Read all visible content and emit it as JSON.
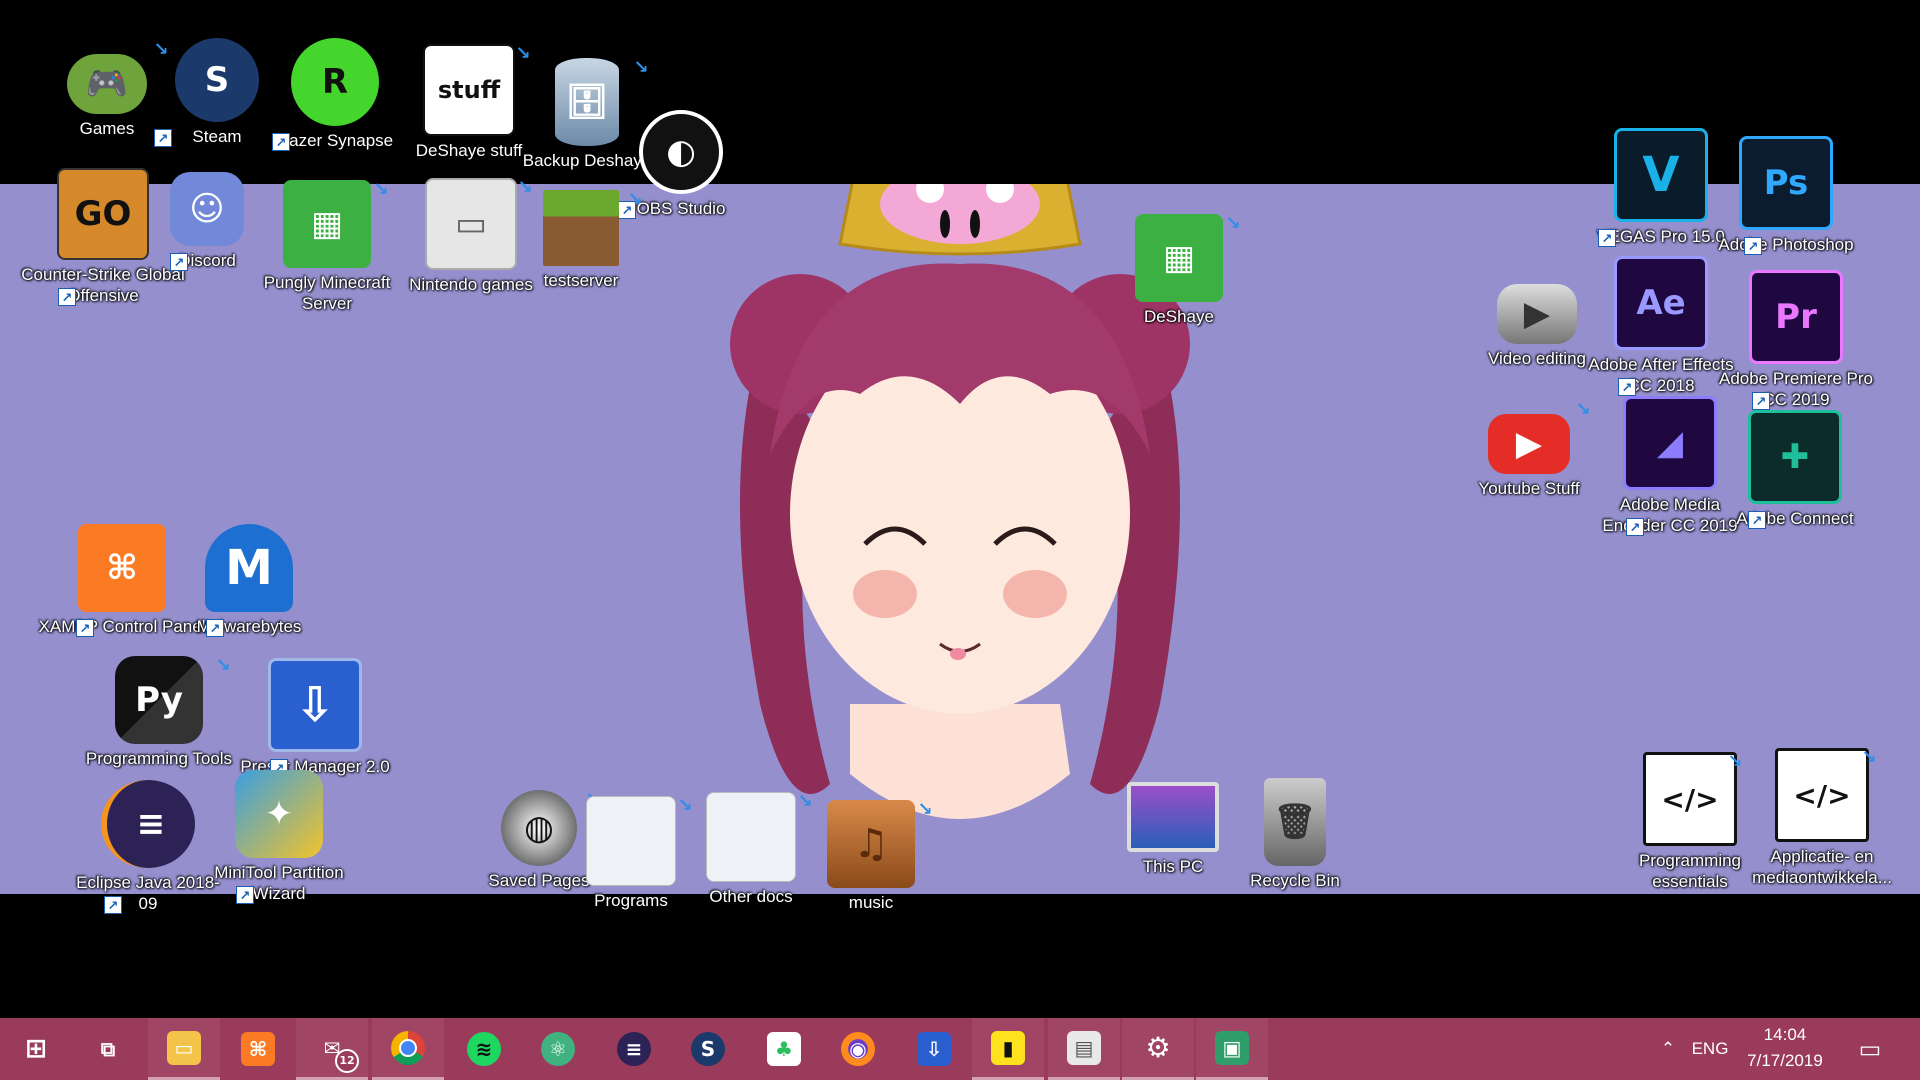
{
  "desktop": {
    "icons": [
      {
        "label": "Games"
      },
      {
        "label": "Steam"
      },
      {
        "label": "Razer Synapse"
      },
      {
        "label": "DeShaye stuff"
      },
      {
        "label": "Backup Deshaye"
      },
      {
        "label": "OBS Studio"
      },
      {
        "label": "Counter-Strike Global Offensive"
      },
      {
        "label": "Discord"
      },
      {
        "label": "Pungly Minecraft Server"
      },
      {
        "label": "Nintendo games"
      },
      {
        "label": "testserver"
      },
      {
        "label": "DeShaye"
      },
      {
        "label": "VEGAS Pro 15.0"
      },
      {
        "label": "Adobe Photoshop CC 2015"
      },
      {
        "label": "Video editing"
      },
      {
        "label": "Adobe After Effects CC 2018"
      },
      {
        "label": "Adobe Premiere Pro CC 2019"
      },
      {
        "label": "Youtube Stuff"
      },
      {
        "label": "Adobe Media Encoder CC 2019"
      },
      {
        "label": "Adobe Connect"
      },
      {
        "label": "XAMPP Control Panel"
      },
      {
        "label": "Malwarebytes"
      },
      {
        "label": "Programming Tools"
      },
      {
        "label": "Preset Manager 2.0"
      },
      {
        "label": "Eclipse Java 2018-09"
      },
      {
        "label": "MiniTool Partition Wizard"
      },
      {
        "label": "Saved Pages"
      },
      {
        "label": "Programs"
      },
      {
        "label": "Other docs"
      },
      {
        "label": "music"
      },
      {
        "label": "This PC"
      },
      {
        "label": "Recycle Bin"
      },
      {
        "label": "Programming essentials"
      },
      {
        "label": "Applicatie- en mediaontwikkela..."
      }
    ],
    "glyphs": {
      "steam": "S",
      "razer": "R",
      "stuff": "stuff",
      "go": "GO",
      "vegas": "V",
      "ps": "Ps",
      "ae": "Ae",
      "pr": "Pr",
      "xampp": "⌘",
      "malware": "M",
      "python": "Py",
      "eclipse": "≡"
    }
  },
  "taskbar": {
    "mail_badge": "12",
    "language": "ENG",
    "time": "14:04",
    "date": "7/17/2019"
  },
  "colors": {
    "wallpaper": "#958fce",
    "taskbar": "#9b3b5b"
  }
}
